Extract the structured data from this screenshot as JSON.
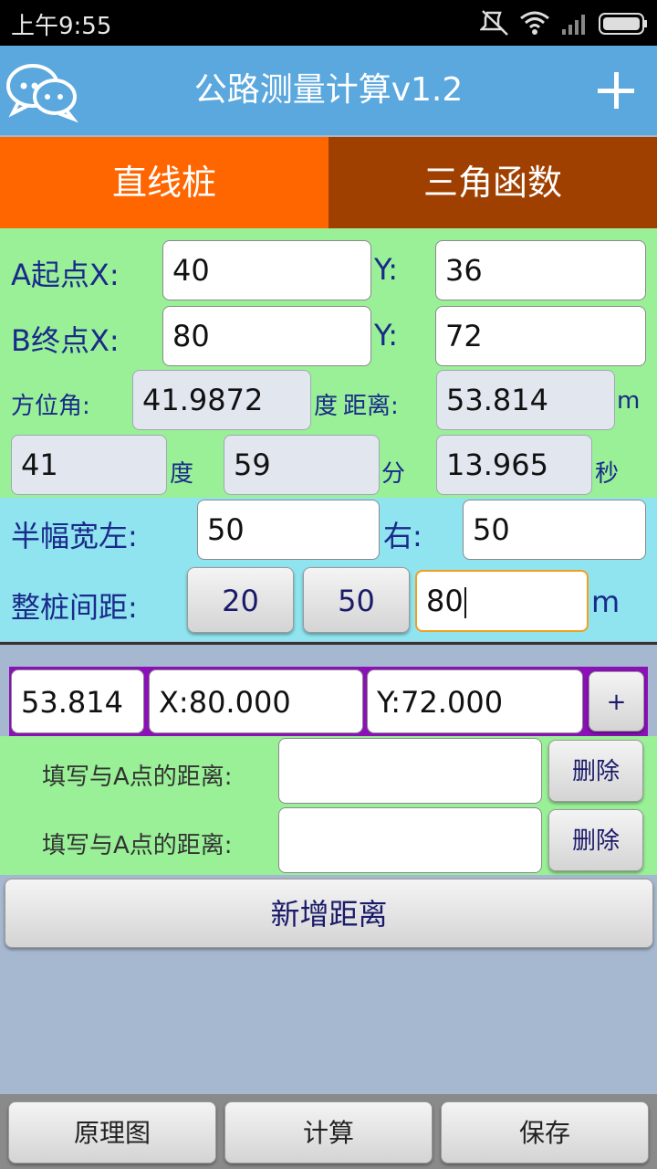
{
  "status": {
    "time": "上午9:55"
  },
  "header": {
    "title": "公路测量计算v1.2",
    "add_icon": "plus-icon",
    "logo_icon": "chat-bubbles-icon"
  },
  "tabs": [
    {
      "label": "直线桩"
    },
    {
      "label": "三角函数"
    }
  ],
  "points": {
    "a_label": "A起点X:",
    "a_x": "40",
    "y_label": "Y:",
    "a_y": "36",
    "b_label": "B终点X:",
    "b_x": "80",
    "b_y": "72"
  },
  "azimuth": {
    "label": "方位角:",
    "value": "41.9872",
    "deg_label": "度",
    "dist_label": "距离:",
    "dist_value": "53.814",
    "dist_unit": "m",
    "deg": "41",
    "deg_unit": "度",
    "min": "59",
    "min_unit": "分",
    "sec": "13.965",
    "sec_unit": "秒"
  },
  "half_width": {
    "left_label": "半幅宽左:",
    "left_value": "50",
    "right_label": "右:",
    "right_value": "50"
  },
  "spacing": {
    "label": "整桩间距:",
    "btn1": "20",
    "btn2": "50",
    "value": "80",
    "unit": "m"
  },
  "result": {
    "distance": "53.814",
    "x": "X:80.000",
    "y": "Y:72.000",
    "plus": "+"
  },
  "distance_rows": [
    {
      "label": "填写与A点的距离:",
      "value": "",
      "delete": "删除"
    },
    {
      "label": "填写与A点的距离:",
      "value": "",
      "delete": "删除"
    }
  ],
  "add_distance": "新增距离",
  "bottom": {
    "diagram": "原理图",
    "calc": "计算",
    "save": "保存"
  },
  "colors": {
    "header": "#5ba8de",
    "tab_active": "#ff6600",
    "tab_inactive": "#a04000",
    "panel_green": "#99f097",
    "panel_cyan": "#8fe4ef",
    "result_border": "#8b10b8"
  }
}
